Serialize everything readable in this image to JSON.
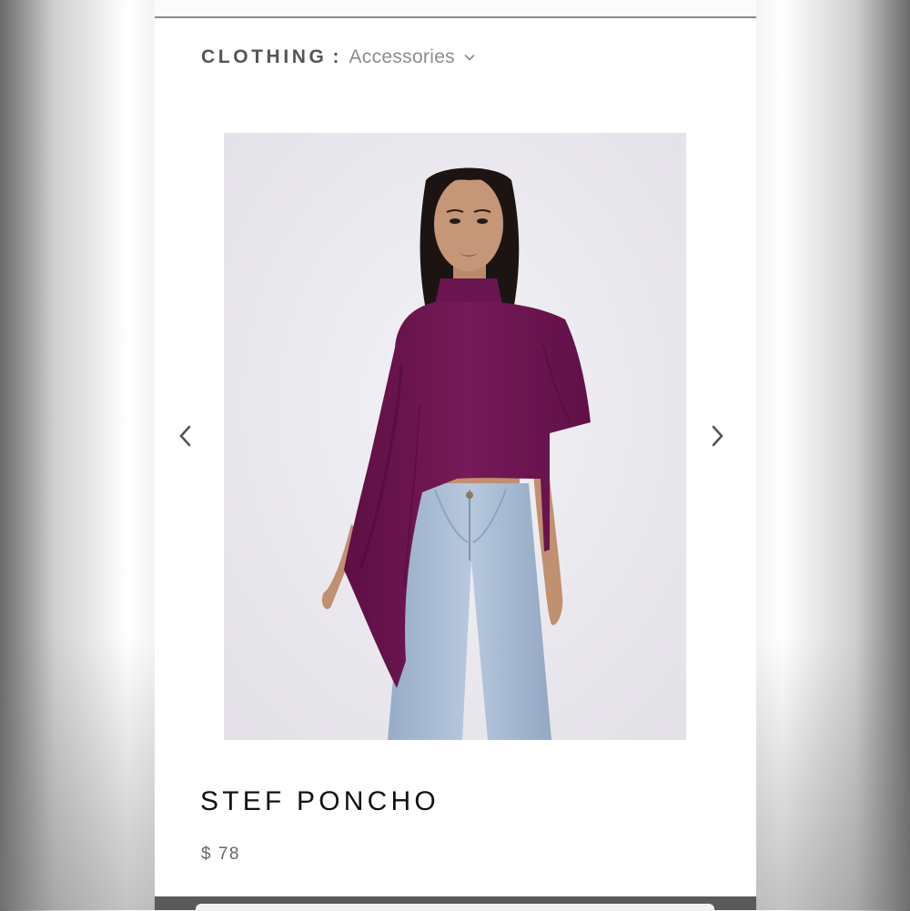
{
  "breadcrumb": {
    "category": "CLOTHING",
    "separator": ":",
    "subcategory": "Accessories"
  },
  "gallery": {
    "image_subject": "model wearing purple knit poncho with turtleneck over cropped top and light-wash jeans",
    "prev_icon": "chevron-left-icon",
    "next_icon": "chevron-right-icon"
  },
  "product": {
    "title": "STEF PONCHO",
    "price": "$ 78"
  },
  "colors": {
    "poncho": "#6e1450",
    "jeans": "#a9bdd6",
    "photo_background": "#ebe9ee",
    "breadcrumb_text": "#555555",
    "title_text": "#111111",
    "price_text": "#666666"
  }
}
